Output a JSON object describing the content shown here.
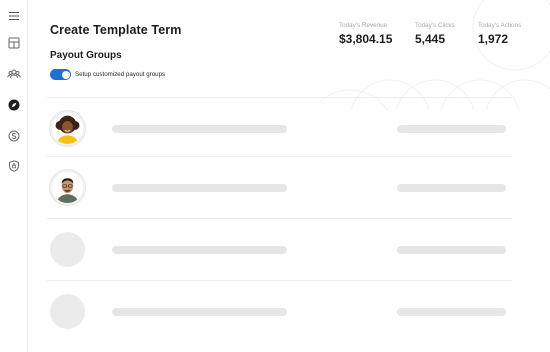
{
  "sidebar": {
    "items": [
      {
        "icon": "menu-icon"
      },
      {
        "icon": "layout-icon"
      },
      {
        "icon": "users-icon"
      },
      {
        "icon": "compass-icon",
        "active": true
      },
      {
        "icon": "dollar-circle-icon"
      },
      {
        "icon": "shield-icon"
      }
    ]
  },
  "page": {
    "title": "Create Template Term"
  },
  "stats": [
    {
      "label": "Today's Revenue",
      "value": "$3,804.15"
    },
    {
      "label": "Today's Clicks",
      "value": "5,445"
    },
    {
      "label": "Today's Actions",
      "value": "1,972"
    }
  ],
  "payout": {
    "section_title": "Payout Groups",
    "toggle_on": true,
    "toggle_label": "Setup customized payout groups"
  },
  "colors": {
    "accent": "#1f6fd6",
    "skeleton": "#e6e6e6"
  },
  "rows": [
    {
      "avatar": "photo-woman"
    },
    {
      "avatar": "photo-man"
    },
    {
      "avatar": "placeholder"
    },
    {
      "avatar": "placeholder"
    }
  ]
}
